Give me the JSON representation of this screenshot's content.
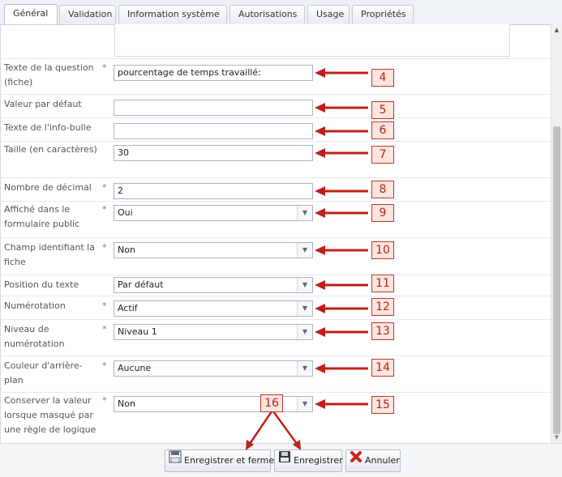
{
  "tabs": [
    "Général",
    "Validation",
    "Information système",
    "Autorisations",
    "Usage",
    "Propriétés"
  ],
  "rows": [
    {
      "label": "Texte de la question (fiche)",
      "required": true,
      "value": "pourcentage de temps travaillé:",
      "callout": "4"
    },
    {
      "label": "Valeur par défaut",
      "required": false,
      "value": "",
      "callout": "5"
    },
    {
      "label": "Texte de l'info-bulle",
      "required": false,
      "value": "",
      "callout": "6"
    },
    {
      "label": "Taille (en caractères)",
      "required": false,
      "value": "30",
      "callout": "7"
    },
    {
      "label": "Nombre de décimal",
      "required": true,
      "value": "2",
      "callout": "8"
    },
    {
      "label": "Affiché dans le formulaire public",
      "required": true,
      "value": "Oui",
      "callout": "9"
    },
    {
      "label": "Champ identifiant la fiche",
      "required": true,
      "value": "Non",
      "callout": "10"
    },
    {
      "label": "Position du texte",
      "required": false,
      "value": "Par défaut",
      "callout": "11"
    },
    {
      "label": "Numérotation",
      "required": true,
      "value": "Actif",
      "callout": "12"
    },
    {
      "label": "Niveau de numérotation",
      "required": true,
      "value": "Niveau 1",
      "callout": "13"
    },
    {
      "label": "Couleur d'arrière-plan",
      "required": true,
      "value": "Aucune",
      "callout": "14"
    },
    {
      "label": "Conserver la valeur lorsque masqué par une règle de logique",
      "required": true,
      "value": "Non",
      "callout": "15"
    }
  ],
  "required_mark": "*",
  "toolbar": {
    "save_close": "Enregistrer et fermer",
    "save": "Enregistrer",
    "cancel": "Annuler",
    "callout": "16"
  },
  "colors": {
    "callout_border": "#c0392b",
    "callout_fill": "#fbe5dc",
    "arrow": "#c0201a"
  }
}
